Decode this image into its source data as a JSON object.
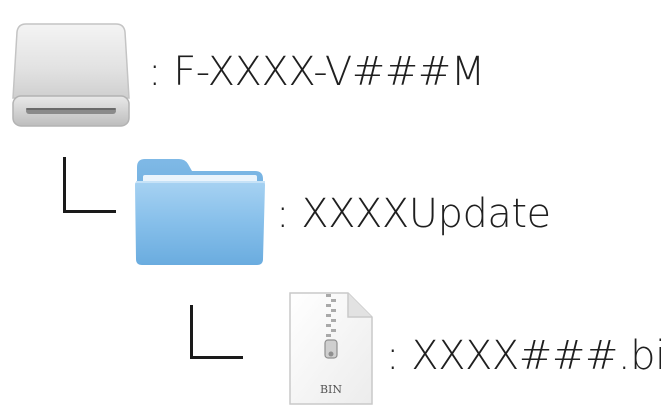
{
  "tree": {
    "drive": {
      "icon": "external-drive-icon",
      "label": ": F-XXXX-V###M"
    },
    "folder": {
      "icon": "folder-icon",
      "label": ": XXXXUpdate"
    },
    "file": {
      "icon": "bin-file-icon",
      "icon_text": "BIN",
      "label": ": XXXX###.bin"
    }
  },
  "colors": {
    "text": "#1f1f1f",
    "connector": "#1a1a1a",
    "folder_blue": "#6fb0e2",
    "drive_gray": "#d8d8d8"
  }
}
